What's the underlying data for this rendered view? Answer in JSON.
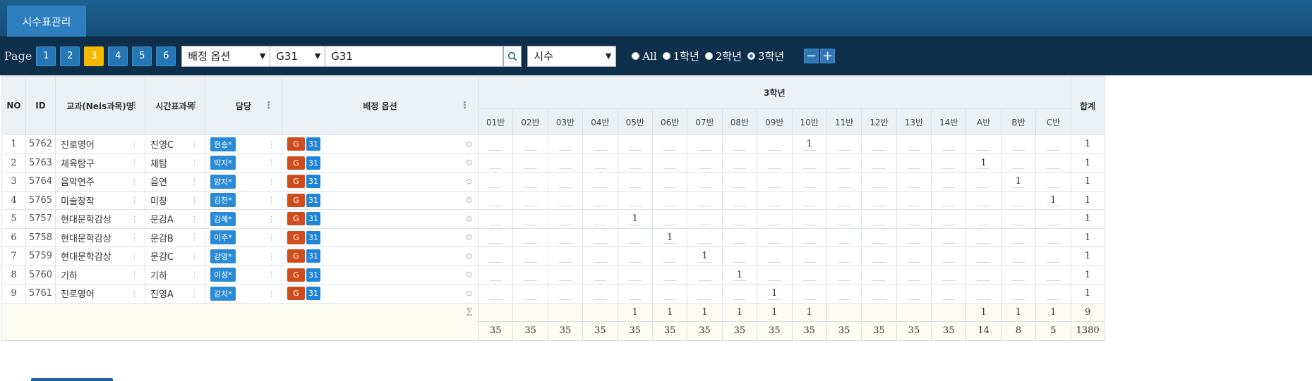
{
  "tab": {
    "label": "시수표관리"
  },
  "toolbar": {
    "page_label": "Page",
    "pages": [
      "1",
      "2",
      "3",
      "4",
      "5",
      "6"
    ],
    "active_page": "3",
    "option_select": "배정 옵션",
    "group_select": "G31",
    "search_value": "G31",
    "type_select": "시수",
    "radios": [
      {
        "label": "All",
        "checked": false
      },
      {
        "label": "1학년",
        "checked": false
      },
      {
        "label": "2학년",
        "checked": false
      },
      {
        "label": "3학년",
        "checked": true
      }
    ],
    "minus_label": "−",
    "plus_label": "+"
  },
  "table": {
    "headers": {
      "no": "NO",
      "id": "ID",
      "subject": "교과(Neis과목)명",
      "short": "시간표과목",
      "teacher": "담당",
      "option": "배정 옵션",
      "grade": "3학년",
      "total": "합계"
    },
    "classes": [
      "01반",
      "02반",
      "03반",
      "04반",
      "05반",
      "06반",
      "07반",
      "08반",
      "09반",
      "10반",
      "11반",
      "12반",
      "13반",
      "14반",
      "A반",
      "B반",
      "C반"
    ],
    "rows": [
      {
        "no": "1",
        "id": "5762",
        "subject": "진로영어",
        "short": "진영C",
        "teacher": "현송*",
        "tag_g": "G",
        "tag_n": "31",
        "cells": [
          "",
          "",
          "",
          "",
          "",
          "",
          "",
          "",
          "",
          "1",
          "",
          "",
          "",
          "",
          "",
          "",
          ""
        ],
        "total": "1"
      },
      {
        "no": "2",
        "id": "5763",
        "subject": "체육탐구",
        "short": "체탐",
        "teacher": "박지*",
        "tag_g": "G",
        "tag_n": "31",
        "cells": [
          "",
          "",
          "",
          "",
          "",
          "",
          "",
          "",
          "",
          "",
          "",
          "",
          "",
          "",
          "1",
          "",
          ""
        ],
        "total": "1"
      },
      {
        "no": "3",
        "id": "5764",
        "subject": "음악연주",
        "short": "음연",
        "teacher": "양지*",
        "tag_g": "G",
        "tag_n": "31",
        "cells": [
          "",
          "",
          "",
          "",
          "",
          "",
          "",
          "",
          "",
          "",
          "",
          "",
          "",
          "",
          "",
          "1",
          ""
        ],
        "total": "1"
      },
      {
        "no": "4",
        "id": "5765",
        "subject": "미술창작",
        "short": "미창",
        "teacher": "김천*",
        "tag_g": "G",
        "tag_n": "31",
        "cells": [
          "",
          "",
          "",
          "",
          "",
          "",
          "",
          "",
          "",
          "",
          "",
          "",
          "",
          "",
          "",
          "",
          "1"
        ],
        "total": "1"
      },
      {
        "no": "5",
        "id": "5757",
        "subject": "현대문학감상",
        "short": "문감A",
        "teacher": "김혜*",
        "tag_g": "G",
        "tag_n": "31",
        "cells": [
          "",
          "",
          "",
          "",
          "1",
          "",
          "",
          "",
          "",
          "",
          "",
          "",
          "",
          "",
          "",
          "",
          ""
        ],
        "total": "1"
      },
      {
        "no": "6",
        "id": "5758",
        "subject": "현대문학감상",
        "short": "문감B",
        "teacher": "이주*",
        "tag_g": "G",
        "tag_n": "31",
        "cells": [
          "",
          "",
          "",
          "",
          "",
          "1",
          "",
          "",
          "",
          "",
          "",
          "",
          "",
          "",
          "",
          "",
          ""
        ],
        "total": "1"
      },
      {
        "no": "7",
        "id": "5759",
        "subject": "현대문학감상",
        "short": "문감C",
        "teacher": "강영*",
        "tag_g": "G",
        "tag_n": "31",
        "cells": [
          "",
          "",
          "",
          "",
          "",
          "",
          "1",
          "",
          "",
          "",
          "",
          "",
          "",
          "",
          "",
          "",
          ""
        ],
        "total": "1"
      },
      {
        "no": "8",
        "id": "5760",
        "subject": "기하",
        "short": "기하",
        "teacher": "이성*",
        "tag_g": "G",
        "tag_n": "31",
        "cells": [
          "",
          "",
          "",
          "",
          "",
          "",
          "",
          "1",
          "",
          "",
          "",
          "",
          "",
          "",
          "",
          "",
          ""
        ],
        "total": "1"
      },
      {
        "no": "9",
        "id": "5761",
        "subject": "진로영어",
        "short": "진영A",
        "teacher": "강치*",
        "tag_g": "G",
        "tag_n": "31",
        "cells": [
          "",
          "",
          "",
          "",
          "",
          "",
          "",
          "",
          "1",
          "",
          "",
          "",
          "",
          "",
          "",
          "",
          ""
        ],
        "total": "1"
      }
    ],
    "sigma": "Σ",
    "sums": [
      "",
      "",
      "",
      "",
      "1",
      "1",
      "1",
      "1",
      "1",
      "1",
      "",
      "",
      "",
      "",
      "1",
      "1",
      "1"
    ],
    "sum_total": "9",
    "capacities": [
      "35",
      "35",
      "35",
      "35",
      "35",
      "35",
      "35",
      "35",
      "35",
      "35",
      "35",
      "35",
      "35",
      "35",
      "14",
      "8",
      "5"
    ],
    "capacity_total": "1380"
  },
  "colors": {
    "header_bg": "#164f78",
    "toolbar_bg": "#0d2f4b",
    "active_page": "#f5b800",
    "tag_g": "#d04c1c",
    "tag_n": "#1f84d6"
  },
  "icons": [
    "search-icon",
    "gear-icon",
    "column-menu-icon"
  ]
}
